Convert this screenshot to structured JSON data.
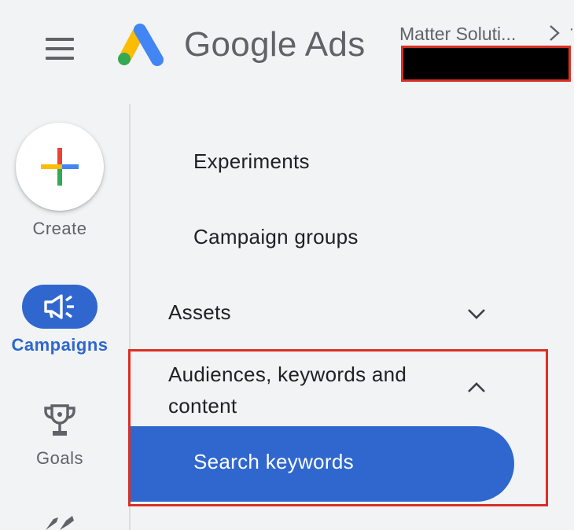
{
  "header": {
    "product_name": "Google Ads",
    "account_name": "Matter Soluti...",
    "next_crumb": "‧",
    "icons": {
      "menu": "menu-icon",
      "chevron": "chevron-right-icon"
    }
  },
  "rail": {
    "create_label": "Create",
    "campaigns_label": "Campaigns",
    "goals_label": "Goals",
    "icons": {
      "create": "plus-icon",
      "campaigns": "megaphone-icon",
      "goals": "trophy-icon",
      "tools": "wrench-icon"
    }
  },
  "nav": {
    "experiments": "Experiments",
    "campaign_groups": "Campaign groups",
    "assets": "Assets",
    "audiences": "Audiences, keywords and content",
    "search_keywords": "Search keywords",
    "icons": {
      "expand": "chevron-down-icon",
      "collapse": "chevron-up-icon"
    }
  },
  "colors": {
    "accent": "#2f67cf",
    "highlight": "#d93025",
    "background": "#f1f3f4",
    "logo_blue": "#4285f4",
    "logo_yellow": "#fbbc04",
    "logo_green": "#34a853",
    "logo_red": "#ea4335"
  }
}
